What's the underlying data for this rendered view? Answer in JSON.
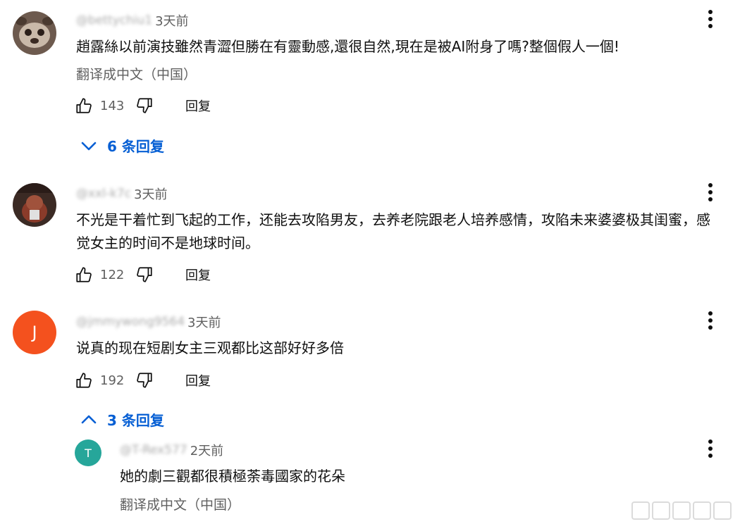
{
  "comments": [
    {
      "time": "3天前",
      "text": "趙露絲以前演技雖然青澀但勝在有靈動感,還很自然,現在是被AI附身了嗎?整個假人一個!",
      "translate": "翻译成中文（中国）",
      "likes": "143",
      "reply": "回复",
      "replies_toggle": "6 条回复"
    },
    {
      "time": "3天前",
      "text": "不光是干着忙到飞起的工作，还能去攻陷男友，去养老院跟老人培养感情，攻陷未来婆婆极其闺蜜，感觉女主的时间不是地球时间。",
      "likes": "122",
      "reply": "回复"
    },
    {
      "avatar_letter": "J",
      "avatar_color": "#f4511e",
      "time": "3天前",
      "text": "说真的现在短剧女主三观都比这部好好多倍",
      "likes": "192",
      "reply": "回复",
      "replies_toggle": "3 条回复"
    }
  ],
  "reply_item": {
    "avatar_color": "#26a69a",
    "time": "2天前",
    "text": "她的劇三觀都很積極荼毒國家的花朵",
    "translate": "翻译成中文（中国）"
  },
  "accent_color": "#065fd4"
}
